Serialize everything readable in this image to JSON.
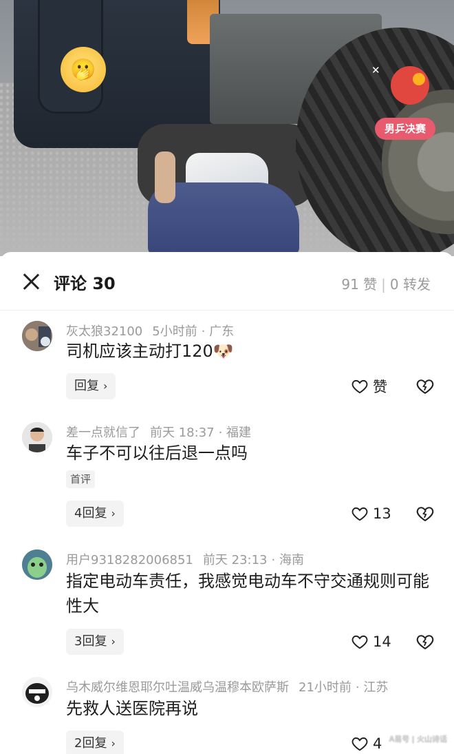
{
  "video": {
    "sticker_emoji": "🫢",
    "close_glyph": "✕",
    "ad_badge": "男乒决赛"
  },
  "sheet": {
    "title": "评论 30",
    "likes_stat": "91 赞",
    "separator": "|",
    "reposts_stat": "0 转发"
  },
  "comments": [
    {
      "username": "灰太狼32100",
      "time": "5小时前",
      "location": "· 广东",
      "text": "司机应该主动打120🐶",
      "reply_label": "回复",
      "like_label": "赞",
      "avatar_color": "#7d6a5f"
    },
    {
      "username": "差一点就信了",
      "time": "前天 18:37",
      "location": "· 福建",
      "text": "车子不可以往后退一点吗",
      "tag": "首评",
      "reply_label": "4回复",
      "like_count": "13",
      "avatar_color": "#d9c4b4"
    },
    {
      "username": "用户9318282006851",
      "time": "前天 23:13",
      "location": "· 海南",
      "text": "指定电动车责任，我感觉电动车不守交通规则可能性大",
      "reply_label": "3回复",
      "like_count": "14",
      "avatar_color": "#6aa98a"
    },
    {
      "username": "乌木威尔维恩耶尔吐温威乌温穆本欧萨斯",
      "time": "21小时前",
      "location": "· 江苏",
      "text": "先救人送医院再说",
      "reply_label": "2回复",
      "like_count": "4",
      "avatar_color": "#e9e9e9"
    }
  ],
  "watermark": "A易号 | 火山诗话",
  "chevron": "›",
  "colors": {
    "badge": "#e85a6e",
    "meta_gray": "#9a9a9a",
    "reply_bg": "#f3f3f3"
  }
}
